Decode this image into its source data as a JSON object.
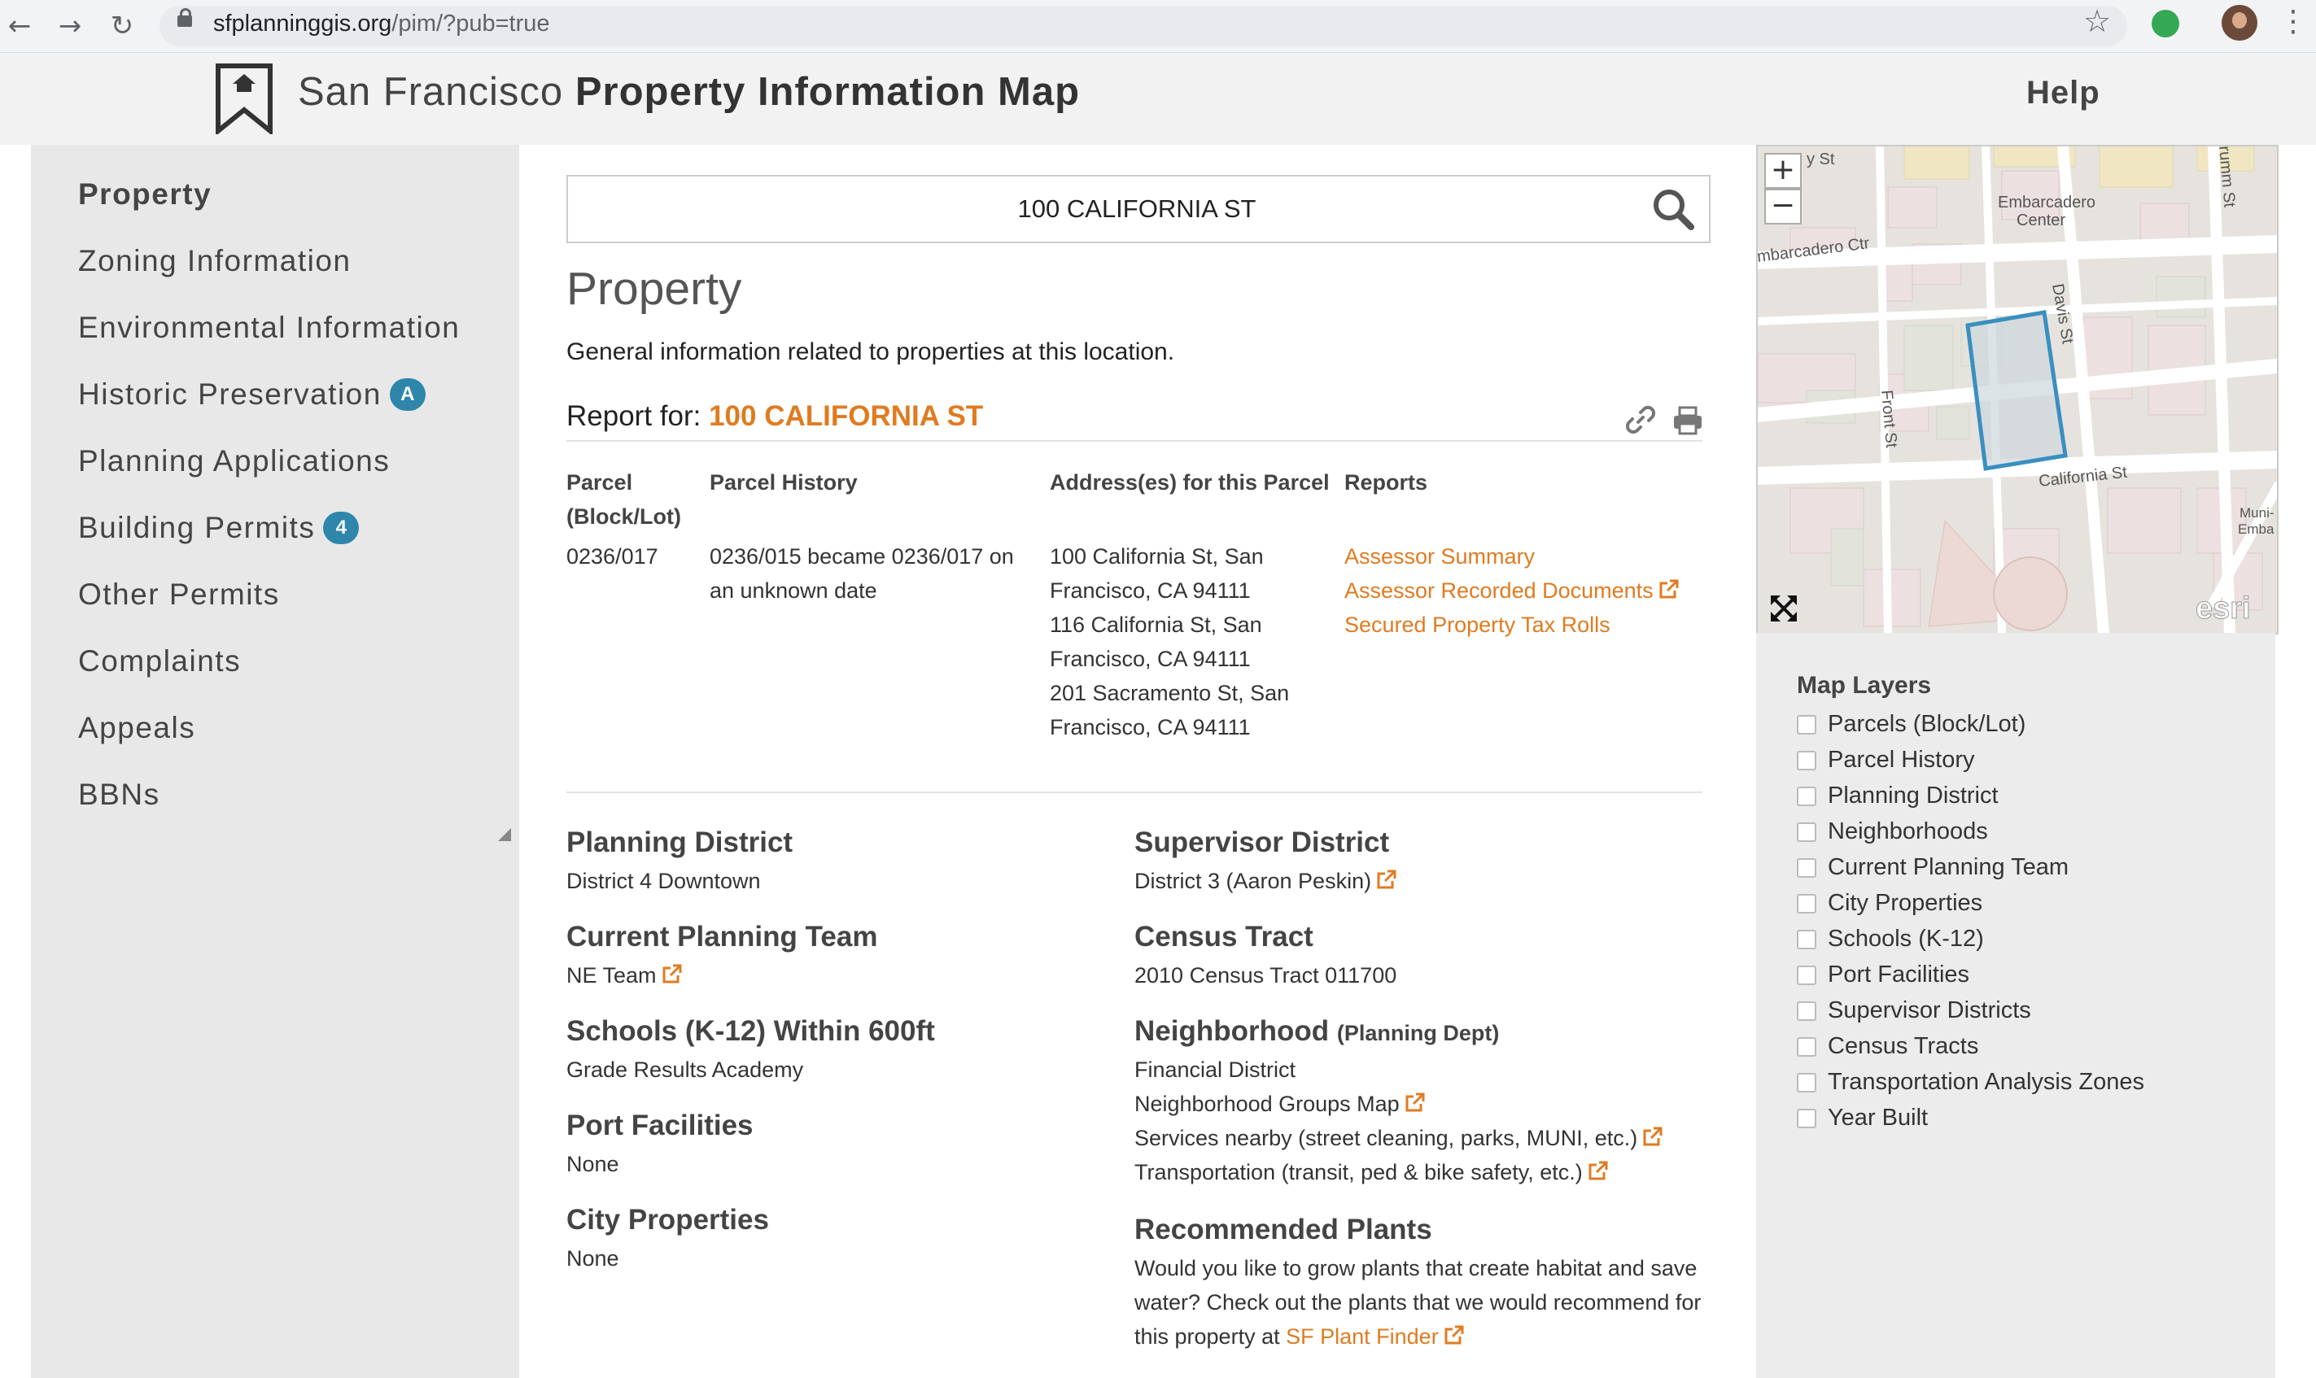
{
  "browser": {
    "url_host": "sfplanninggis.org",
    "url_path": "/pim/?pub=true"
  },
  "header": {
    "title_light": "San Francisco",
    "title_bold": "Property Information Map",
    "help_label": "Help"
  },
  "sidebar": {
    "items": [
      {
        "label": "Property",
        "badge": ""
      },
      {
        "label": "Zoning Information",
        "badge": ""
      },
      {
        "label": "Environmental Information",
        "badge": ""
      },
      {
        "label": "Historic Preservation",
        "badge": "A"
      },
      {
        "label": "Planning Applications",
        "badge": ""
      },
      {
        "label": "Building Permits",
        "badge": "4"
      },
      {
        "label": "Other Permits",
        "badge": ""
      },
      {
        "label": "Complaints",
        "badge": ""
      },
      {
        "label": "Appeals",
        "badge": ""
      },
      {
        "label": "BBNs",
        "badge": ""
      }
    ]
  },
  "search": {
    "value": "100 CALIFORNIA ST"
  },
  "main": {
    "heading": "Property",
    "description": "General information related to properties at this location.",
    "report_for_label": "Report for:",
    "report_for_address": "100 CALIFORNIA ST",
    "parcel_table": {
      "headers": {
        "parcel_line1": "Parcel",
        "parcel_line2": "(Block/Lot)",
        "history": "Parcel History",
        "addresses": "Address(es) for this Parcel",
        "reports": "Reports"
      },
      "parcel": "0236/017",
      "history_lines": [
        "0236/015 became 0236/017 on",
        "an unknown date"
      ],
      "address_lines": [
        "100 California St, San",
        "Francisco, CA 94111",
        "116 California St, San",
        "Francisco, CA 94111",
        "201 Sacramento St, San",
        "Francisco, CA 94111"
      ],
      "reports": [
        "Assessor Summary",
        "Assessor Recorded Documents",
        "Secured Property Tax Rolls"
      ]
    },
    "left_sections": [
      {
        "title": "Planning District",
        "value": "District 4 Downtown"
      },
      {
        "title": "Current Planning Team",
        "value": "NE Team"
      },
      {
        "title": "Schools (K-12) Within 600ft",
        "value": "Grade Results Academy"
      },
      {
        "title": "Port Facilities",
        "value": "None"
      },
      {
        "title": "City Properties",
        "value": "None"
      }
    ],
    "right_sections": {
      "supervisor": {
        "title": "Supervisor District",
        "value": "District 3 (Aaron Peskin)"
      },
      "census": {
        "title": "Census Tract",
        "value": "2010 Census Tract 011700"
      },
      "neighborhood": {
        "title": "Neighborhood",
        "subtitle": "(Planning Dept)",
        "value": "Financial District",
        "links": [
          "Neighborhood Groups Map",
          "Services nearby (street cleaning, parks, MUNI, etc.)",
          "Transportation (transit, ped & bike safety, etc.)"
        ]
      },
      "plants": {
        "title": "Recommended Plants",
        "lines": [
          "Would you like to grow plants that create habitat and save",
          "water? Check out the plants that we would recommend for"
        ],
        "last_line_prefix": "this property at",
        "link": "SF Plant Finder"
      }
    }
  },
  "map": {
    "zoom_in": "+",
    "zoom_out": "−",
    "labels": {
      "embarcadero_center_1": "Embarcadero",
      "embarcadero_center_2": "Center",
      "embarcadero_ctr": "mbarcadero Ctr",
      "davis": "Davis St",
      "front": "Front St",
      "california": "California St",
      "drumm": "rumm St",
      "y_st": "y St",
      "muni_1": "Muni-",
      "muni_2": "Emba",
      "esri": "esri"
    },
    "colors": {
      "parcel_outline": "#3a8fc0",
      "accent": "#e07b20"
    }
  },
  "layers": {
    "title": "Map Layers",
    "items": [
      "Parcels (Block/Lot)",
      "Parcel History",
      "Planning District",
      "Neighborhoods",
      "Current Planning Team",
      "City Properties",
      "Schools (K-12)",
      "Port Facilities",
      "Supervisor Districts",
      "Census Tracts",
      "Transportation Analysis Zones",
      "Year Built"
    ]
  }
}
